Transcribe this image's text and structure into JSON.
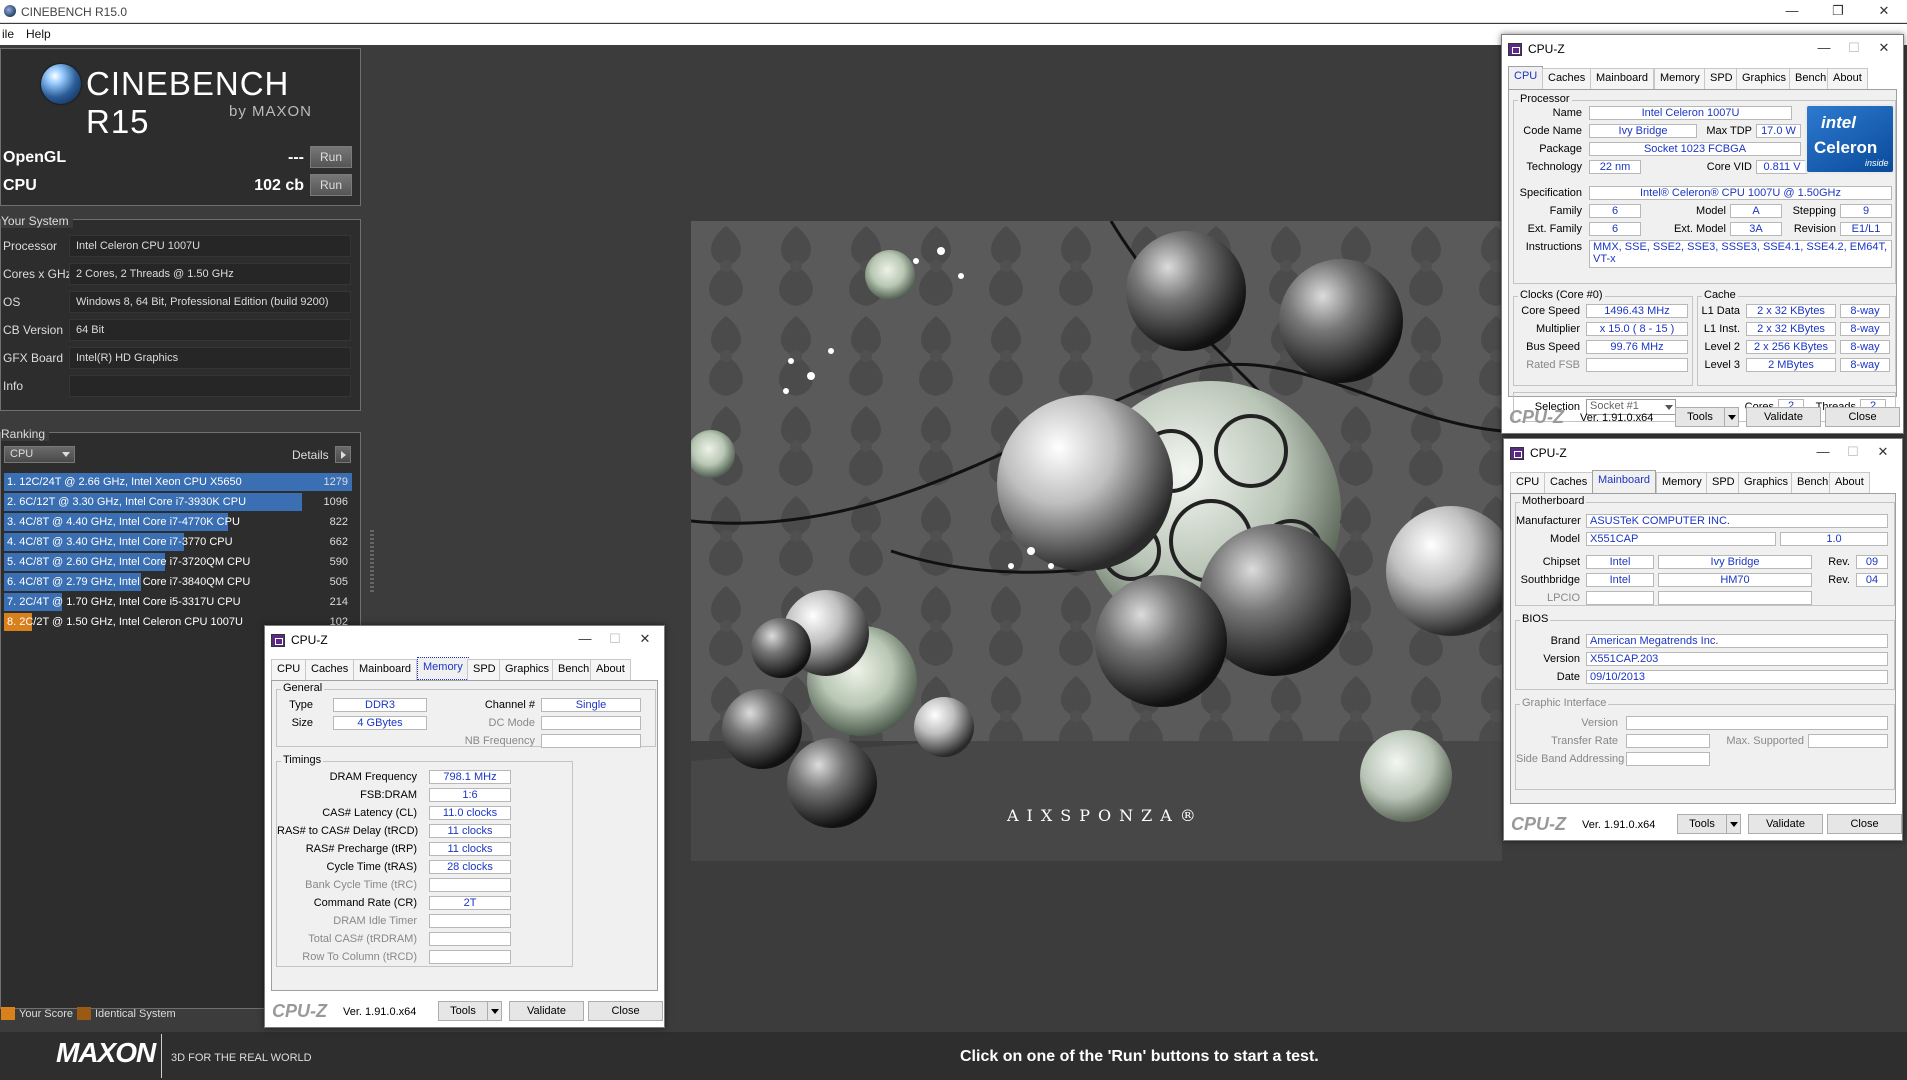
{
  "app": {
    "title": "CINEBENCH R15.0",
    "menu": [
      "ile",
      "Help"
    ]
  },
  "logo": {
    "title": "CINEBENCH R15",
    "by": "by MAXON"
  },
  "benchmarks": [
    {
      "label": "OpenGL",
      "value": "---",
      "button": "Run"
    },
    {
      "label": "CPU",
      "value": "102 cb",
      "button": "Run"
    }
  ],
  "system": {
    "title": "Your System",
    "rows": [
      {
        "key": "Processor",
        "value": "Intel Celeron CPU 1007U"
      },
      {
        "key": "Cores x GHz",
        "value": "2 Cores, 2 Threads @ 1.50 GHz"
      },
      {
        "key": "OS",
        "value": "Windows 8, 64 Bit, Professional Edition (build 9200)"
      },
      {
        "key": "CB Version",
        "value": "64 Bit"
      },
      {
        "key": "GFX Board",
        "value": "Intel(R) HD Graphics"
      },
      {
        "key": "Info",
        "value": ""
      }
    ]
  },
  "ranking": {
    "title": "Ranking",
    "select": "CPU",
    "details": "Details",
    "max_score": 1279,
    "rows": [
      {
        "text": "1. 12C/24T @ 2.66 GHz, Intel Xeon CPU X5650",
        "score": 1279,
        "mine": false
      },
      {
        "text": "2. 6C/12T @ 3.30 GHz,  Intel Core i7-3930K CPU",
        "score": 1096,
        "mine": false
      },
      {
        "text": "3. 4C/8T @ 4.40 GHz, Intel Core i7-4770K CPU",
        "score": 822,
        "mine": false
      },
      {
        "text": "4. 4C/8T @ 3.40 GHz,  Intel Core i7-3770 CPU",
        "score": 662,
        "mine": false
      },
      {
        "text": "5. 4C/8T @ 2.60 GHz, Intel Core i7-3720QM CPU",
        "score": 590,
        "mine": false
      },
      {
        "text": "6. 4C/8T @ 2.79 GHz,  Intel Core i7-3840QM CPU",
        "score": 505,
        "mine": false
      },
      {
        "text": "7. 2C/4T @ 1.70 GHz,  Intel Core i5-3317U CPU",
        "score": 214,
        "mine": false
      },
      {
        "text": "8. 2C/2T @ 1.50 GHz,  Intel Celeron CPU 1007U",
        "score": 102,
        "mine": true
      }
    ]
  },
  "legend": {
    "your_score": "Your Score",
    "identical": "Identical System",
    "your_color": "#d7801c",
    "identical_color": "#9a5a14"
  },
  "footer": {
    "brand": "MAXON",
    "tagline": "3D FOR THE REAL WORLD",
    "status": "Click on one of the 'Run' buttons to start a test."
  },
  "render": {
    "watermark": "AIXSPONZA®"
  },
  "cpuz_common": {
    "title": "CPU-Z",
    "tabs": [
      "CPU",
      "Caches",
      "Mainboard",
      "Memory",
      "SPD",
      "Graphics",
      "Bench",
      "About"
    ],
    "brand": "CPU-Z",
    "version": "Ver. 1.91.0.x64",
    "tools": "Tools",
    "validate": "Validate",
    "close": "Close"
  },
  "cpuz_cpu": {
    "processor_title": "Processor",
    "name_k": "Name",
    "name": "Intel Celeron 1007U",
    "codename_k": "Code Name",
    "codename": "Ivy Bridge",
    "maxtdp_k": "Max TDP",
    "maxtdp": "17.0 W",
    "package_k": "Package",
    "package": "Socket 1023 FCBGA",
    "tech_k": "Technology",
    "tech": "22 nm",
    "corevid_k": "Core VID",
    "corevid": "0.811 V",
    "spec_k": "Specification",
    "spec": "Intel® Celeron® CPU 1007U @ 1.50GHz",
    "family_k": "Family",
    "family": "6",
    "model_k": "Model",
    "model": "A",
    "stepping_k": "Stepping",
    "stepping": "9",
    "extfamily_k": "Ext. Family",
    "extfamily": "6",
    "extmodel_k": "Ext. Model",
    "extmodel": "3A",
    "revision_k": "Revision",
    "revision": "E1/L1",
    "instr_k": "Instructions",
    "instr": "MMX, SSE, SSE2, SSE3, SSSE3, SSE4.1, SSE4.2, EM64T, VT-x",
    "clocks_title": "Clocks (Core #0)",
    "corespeed_k": "Core Speed",
    "corespeed": "1496.43 MHz",
    "mult_k": "Multiplier",
    "mult": "x 15.0 ( 8 - 15 )",
    "bus_k": "Bus Speed",
    "bus": "99.76 MHz",
    "fsb_k": "Rated FSB",
    "fsb": "",
    "cache_title": "Cache",
    "l1d_k": "L1 Data",
    "l1d": "2 x 32 KBytes",
    "l1d_w": "8-way",
    "l1i_k": "L1 Inst.",
    "l1i": "2 x 32 KBytes",
    "l1i_w": "8-way",
    "l2_k": "Level 2",
    "l2": "2 x 256 KBytes",
    "l2_w": "8-way",
    "l3_k": "Level 3",
    "l3": "2 MBytes",
    "l3_w": "8-way",
    "selection_k": "Selection",
    "selection": "Socket #1",
    "cores_k": "Cores",
    "cores": "2",
    "threads_k": "Threads",
    "threads": "2",
    "intel_logo": "intel",
    "intel_brand": "Celeron",
    "intel_inside": "inside"
  },
  "cpuz_mb": {
    "mb_title": "Motherboard",
    "manu_k": "Manufacturer",
    "manu": "ASUSTeK COMPUTER INC.",
    "model_k": "Model",
    "model": "X551CAP",
    "model_rev": "1.0",
    "chipset_k": "Chipset",
    "chipset_v": "Intel",
    "chipset": "Ivy Bridge",
    "chipset_rev_k": "Rev.",
    "chipset_rev": "09",
    "sb_k": "Southbridge",
    "sb_v": "Intel",
    "sb": "HM70",
    "sb_rev_k": "Rev.",
    "sb_rev": "04",
    "lpcio_k": "LPCIO",
    "bios_title": "BIOS",
    "brand_k": "Brand",
    "brand": "American Megatrends Inc.",
    "version_k": "Version",
    "version": "X551CAP.203",
    "date_k": "Date",
    "date": "09/10/2013",
    "gi_title": "Graphic Interface",
    "gi_version_k": "Version",
    "gi_rate_k": "Transfer Rate",
    "gi_max_k": "Max. Supported",
    "gi_sba_k": "Side Band Addressing"
  },
  "cpuz_mem": {
    "general_title": "General",
    "type_k": "Type",
    "type": "DDR3",
    "size_k": "Size",
    "size": "4 GBytes",
    "channel_k": "Channel #",
    "channel": "Single",
    "dcmode_k": "DC Mode",
    "nbfreq_k": "NB Frequency",
    "timings_title": "Timings",
    "timings": [
      {
        "k": "DRAM Frequency",
        "v": "798.1 MHz",
        "dim": false
      },
      {
        "k": "FSB:DRAM",
        "v": "1:6",
        "dim": false
      },
      {
        "k": "CAS# Latency (CL)",
        "v": "11.0 clocks",
        "dim": false
      },
      {
        "k": "RAS# to CAS# Delay (tRCD)",
        "v": "11 clocks",
        "dim": false
      },
      {
        "k": "RAS# Precharge (tRP)",
        "v": "11 clocks",
        "dim": false
      },
      {
        "k": "Cycle Time (tRAS)",
        "v": "28 clocks",
        "dim": false
      },
      {
        "k": "Bank Cycle Time (tRC)",
        "v": "",
        "dim": true
      },
      {
        "k": "Command Rate (CR)",
        "v": "2T",
        "dim": false
      },
      {
        "k": "DRAM Idle Timer",
        "v": "",
        "dim": true
      },
      {
        "k": "Total CAS# (tRDRAM)",
        "v": "",
        "dim": true
      },
      {
        "k": "Row To Column (tRCD)",
        "v": "",
        "dim": true
      }
    ]
  }
}
